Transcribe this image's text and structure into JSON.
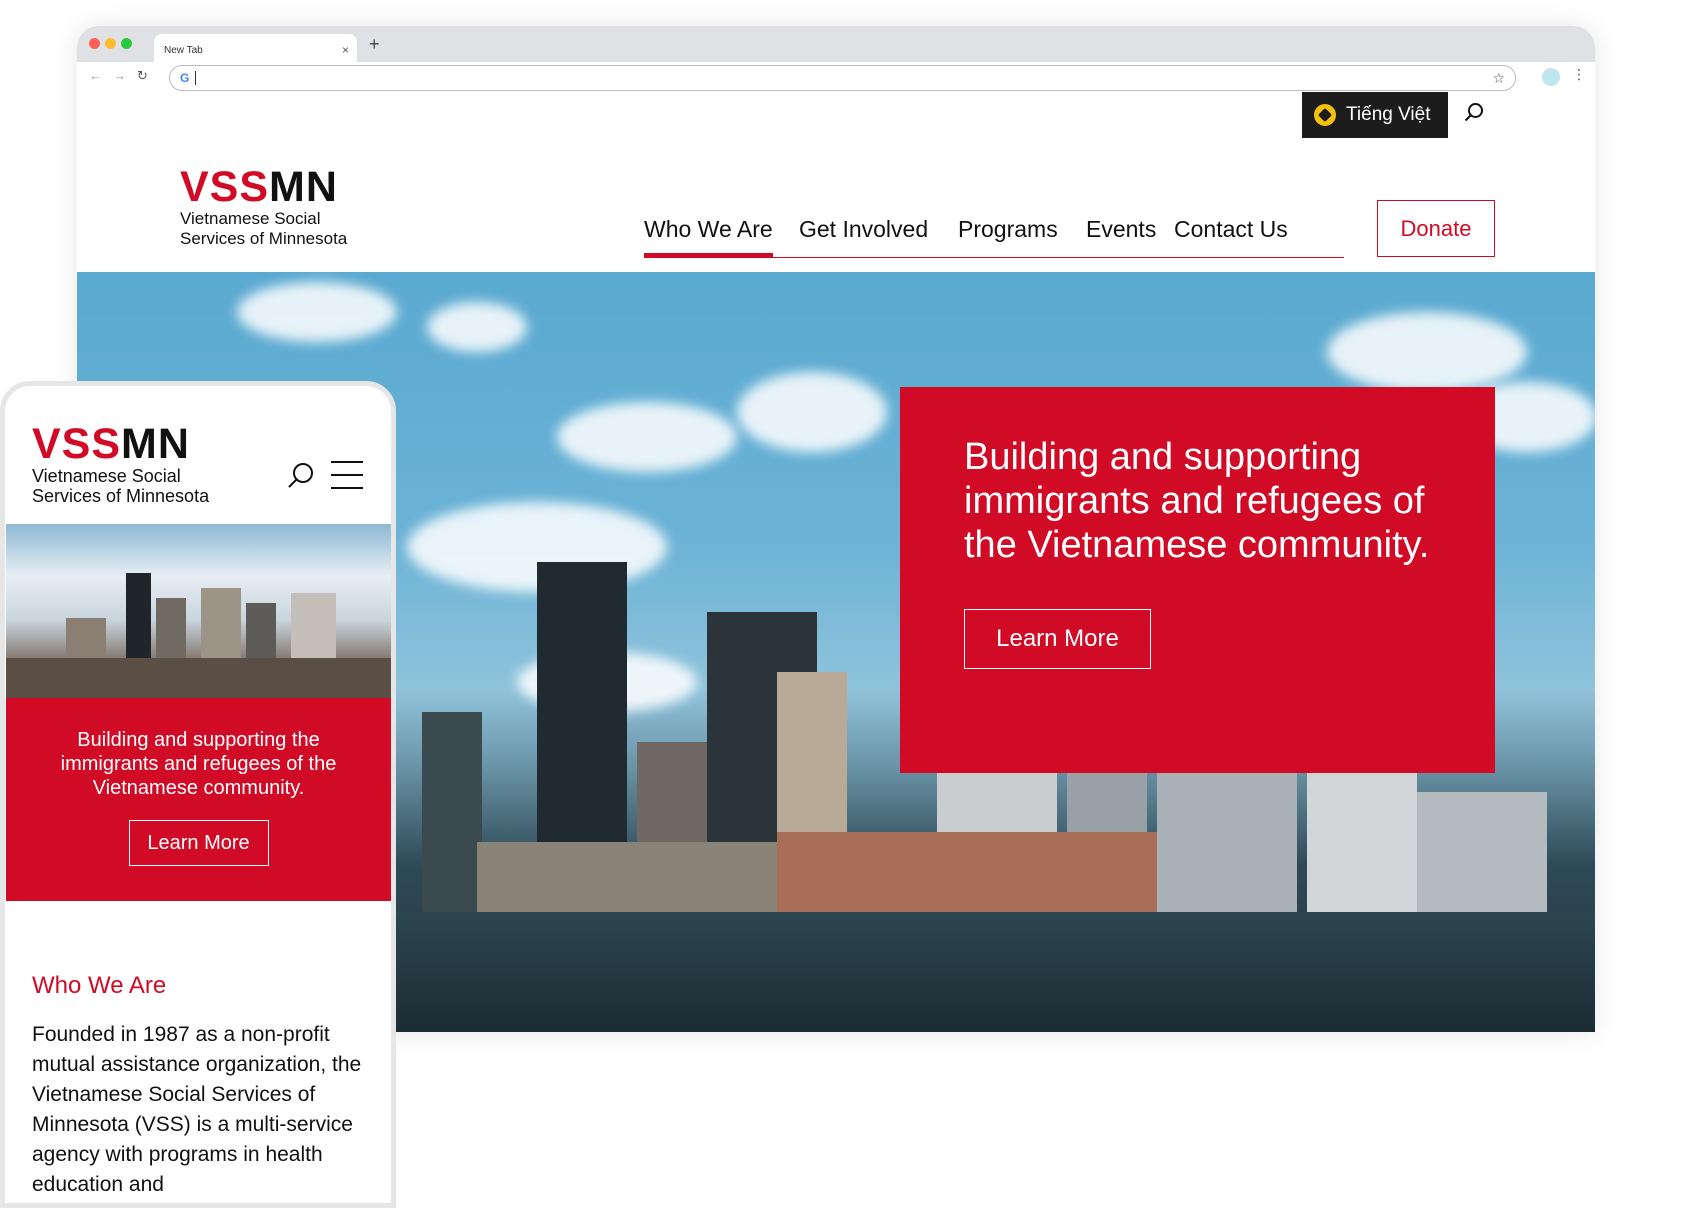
{
  "browser": {
    "tab_title": "New Tab",
    "tab_close": "×",
    "new_tab": "+",
    "back": "←",
    "forward": "→",
    "reload": "↻",
    "omnibox_icon": "G",
    "bookmark_star": "☆",
    "menu_kebab": "⋮"
  },
  "site": {
    "lang_label": "Tiếng Việt",
    "logo_red": "VSS",
    "logo_black": "MN",
    "logo_line1": "Vietnamese Social",
    "logo_line2": "Services of Minnesota",
    "nav": [
      "Who We Are",
      "Get Involved",
      "Programs",
      "Events",
      "Contact Us"
    ],
    "donate": "Donate",
    "hero_title": "Building and supporting immigrants and refugees of the Vietnamese community.",
    "hero_button": "Learn More"
  },
  "mobile": {
    "hero_title": "Building and supporting the immigrants and refugees of the Vietnamese community.",
    "hero_button": "Learn More",
    "section_heading": "Who We Are",
    "section_body": "Founded in 1987 as a non-profit mutual assistance organization, the Vietnamese Social Services of Minnesota (VSS) is a multi-service agency with programs in health education and"
  },
  "colors": {
    "brand_red": "#d10a25",
    "dark": "#1c1c1c",
    "text": "#111111"
  }
}
